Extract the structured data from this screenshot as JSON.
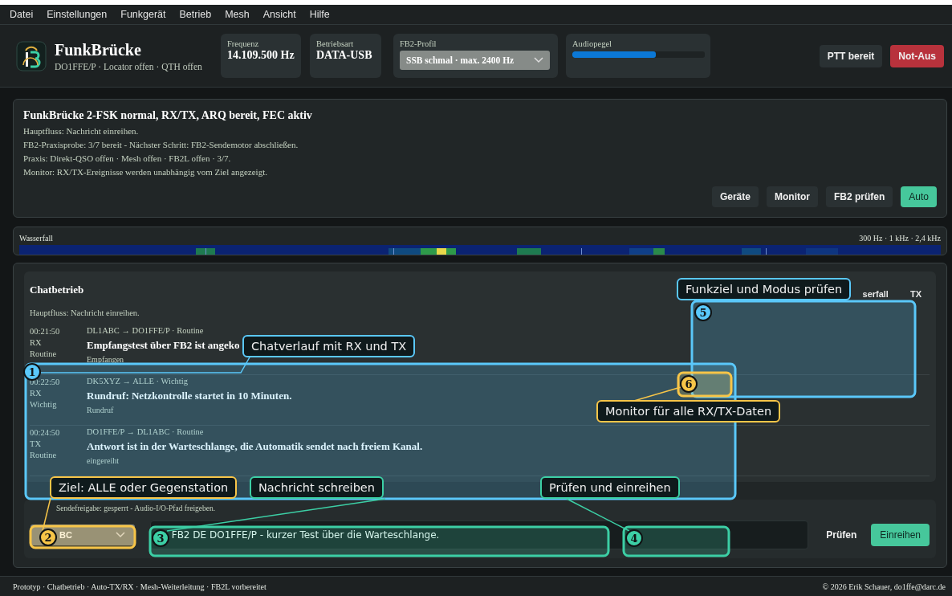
{
  "menu": [
    "Datei",
    "Einstellungen",
    "Funkgerät",
    "Betrieb",
    "Mesh",
    "Ansicht",
    "Hilfe"
  ],
  "header": {
    "app_name": "FunkBrücke",
    "subtitle": "DO1FFE/P · Locator offen · QTH offen",
    "frequency": {
      "label": "Frequenz",
      "value": "14.109.500 Hz"
    },
    "mode": {
      "label": "Betriebsart",
      "value": "DATA-USB"
    },
    "profile": {
      "label": "FB2-Profil",
      "value": "SSB schmal · max. 2400 Hz"
    },
    "audio": {
      "label": "Audiopegel",
      "level": 0.63
    },
    "buttons": [
      {
        "label": "PTT bereit",
        "kind": "neutral"
      },
      {
        "label": "Not-Aus",
        "kind": "danger"
      }
    ]
  },
  "status": {
    "title": "FunkBrücke 2-FSK normal, RX/TX, ARQ bereit, FEC aktiv",
    "lines": [
      "Hauptfluss: Nachricht einreihen.",
      "FB2-Praxisprobe: 3/7 bereit - Nächster Schritt: FB2-Sendemotor abschließen.",
      "Praxis: Direkt-QSO offen · Mesh offen · FB2L offen · 3/7.",
      "Monitor: RX/TX-Ereignisse werden unabhängig vom Ziel angezeigt."
    ],
    "buttons": [
      {
        "label": "Geräte",
        "selected": false
      },
      {
        "label": "Monitor",
        "selected": false
      },
      {
        "label": "FB2 prüfen",
        "selected": false
      },
      {
        "label": "Auto",
        "selected": true
      }
    ]
  },
  "waterfall": {
    "label": "Wasserfall",
    "scale": "300 Hz · 1 kHz · 2,4 kHz"
  },
  "chat": {
    "title": "Chatbetrieb",
    "header_labels": [
      "serfall",
      "TX"
    ],
    "flow": "Hauptfluss: Nachricht einreihen.",
    "messages": [
      {
        "time": "00:21:50",
        "direction": "RX",
        "priority": "Routine",
        "route": "DL1ABC → DO1FFE/P · Routine",
        "text": "Empfangstest über FB2 ist angeko",
        "status": "Empfangen"
      },
      {
        "time": "00:22:50",
        "direction": "RX",
        "priority": "Wichtig",
        "route": "DK5XYZ → ALLE · Wichtig",
        "text": "Rundruf: Netzkontrolle startet in 10 Minuten.",
        "status": "Rundruf"
      },
      {
        "time": "00:24:50",
        "direction": "TX",
        "priority": "Routine",
        "route": "DO1FFE/P → DL1ABC · Routine",
        "text": "Antwort ist in der Warteschlange, die Automatik sendet nach freiem Kanal.",
        "status": "eingereiht"
      }
    ]
  },
  "composer": {
    "notice": "Sendefreigabe: gesperrt - Audio-I/O-Pfad freigeben.",
    "target": "BC",
    "message": "FB2 DE DO1FFE/P - kurzer Test über die Warteschlange.",
    "buttons": [
      {
        "label": "Prüfen",
        "kind": "plain"
      },
      {
        "label": "Einreihen",
        "kind": "primary"
      }
    ]
  },
  "footer": {
    "left": "Prototyp · Chatbetrieb · Auto-TX/RX · Mesh-Weiterleitung · FB2L vorbereitet",
    "right": "© 2026 Erik Schauer, do1ffe@darc.de"
  },
  "annotations": [
    {
      "number": "1",
      "label": "Chatverlauf mit RX und TX",
      "color": "#5ac8fa"
    },
    {
      "number": "2",
      "label": "Ziel: ALLE oder Gegenstation",
      "color": "#f7c548"
    },
    {
      "number": "3",
      "label": "Nachricht schreiben",
      "color": "#3ccfa5"
    },
    {
      "number": "4",
      "label": "Prüfen und einreihen",
      "color": "#3ccfa5"
    },
    {
      "number": "5",
      "label": "Funkziel und Modus prüfen",
      "color": "#5ac8fa"
    },
    {
      "number": "6",
      "label": "Monitor für alle RX/TX-Daten",
      "color": "#f7c548"
    }
  ]
}
